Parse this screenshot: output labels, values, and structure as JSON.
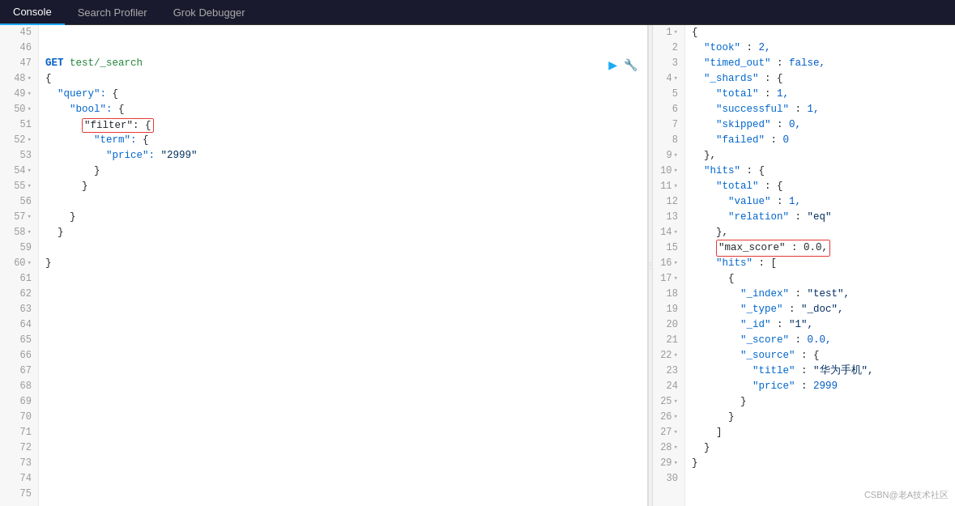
{
  "nav": {
    "tabs": [
      {
        "id": "console",
        "label": "Console",
        "active": true
      },
      {
        "id": "search-profiler",
        "label": "Search Profiler",
        "active": false
      },
      {
        "id": "grok-debugger",
        "label": "Grok Debugger",
        "active": false
      }
    ]
  },
  "editor": {
    "lines": [
      {
        "num": "45",
        "fold": false,
        "content": "",
        "type": "empty"
      },
      {
        "num": "46",
        "fold": false,
        "content": "",
        "type": "empty"
      },
      {
        "num": "47",
        "fold": false,
        "content": "GET test/_search",
        "type": "method"
      },
      {
        "num": "48",
        "fold": true,
        "content": "{",
        "type": "brace"
      },
      {
        "num": "49",
        "fold": true,
        "content": "  \"query\": {",
        "type": "key-brace"
      },
      {
        "num": "50",
        "fold": true,
        "content": "    \"bool\": {",
        "type": "key-brace"
      },
      {
        "num": "51",
        "fold": false,
        "content": "      \"filter\": {",
        "type": "highlighted-key",
        "highlight": true
      },
      {
        "num": "52",
        "fold": true,
        "content": "        \"term\": {",
        "type": "key-brace"
      },
      {
        "num": "53",
        "fold": false,
        "content": "          \"price\": \"2999\"",
        "type": "key-val"
      },
      {
        "num": "54",
        "fold": true,
        "content": "        }",
        "type": "brace"
      },
      {
        "num": "55",
        "fold": true,
        "content": "      }",
        "type": "brace"
      },
      {
        "num": "56",
        "fold": false,
        "content": "",
        "type": "empty"
      },
      {
        "num": "57",
        "fold": true,
        "content": "    }",
        "type": "brace"
      },
      {
        "num": "58",
        "fold": true,
        "content": "  }",
        "type": "brace"
      },
      {
        "num": "59",
        "fold": false,
        "content": "",
        "type": "empty"
      },
      {
        "num": "60",
        "fold": true,
        "content": "}",
        "type": "brace"
      },
      {
        "num": "61",
        "fold": false,
        "content": "",
        "type": "empty"
      },
      {
        "num": "62",
        "fold": false,
        "content": "",
        "type": "empty"
      },
      {
        "num": "63",
        "fold": false,
        "content": "",
        "type": "empty"
      },
      {
        "num": "64",
        "fold": false,
        "content": "",
        "type": "empty"
      },
      {
        "num": "65",
        "fold": false,
        "content": "",
        "type": "empty"
      },
      {
        "num": "66",
        "fold": false,
        "content": "",
        "type": "empty"
      },
      {
        "num": "67",
        "fold": false,
        "content": "",
        "type": "empty"
      },
      {
        "num": "68",
        "fold": false,
        "content": "",
        "type": "empty"
      },
      {
        "num": "69",
        "fold": false,
        "content": "",
        "type": "empty"
      },
      {
        "num": "70",
        "fold": false,
        "content": "",
        "type": "empty"
      },
      {
        "num": "71",
        "fold": false,
        "content": "",
        "type": "empty"
      },
      {
        "num": "72",
        "fold": false,
        "content": "",
        "type": "empty"
      },
      {
        "num": "73",
        "fold": false,
        "content": "",
        "type": "empty"
      },
      {
        "num": "74",
        "fold": false,
        "content": "",
        "type": "empty"
      },
      {
        "num": "75",
        "fold": false,
        "content": "",
        "type": "empty"
      }
    ]
  },
  "response": {
    "lines": [
      {
        "num": "1",
        "fold": true,
        "content": "{"
      },
      {
        "num": "2",
        "fold": false,
        "content": "  \"took\" : 2,"
      },
      {
        "num": "3",
        "fold": false,
        "content": "  \"timed_out\" : false,"
      },
      {
        "num": "4",
        "fold": true,
        "content": "  \"_shards\" : {"
      },
      {
        "num": "5",
        "fold": false,
        "content": "    \"total\" : 1,"
      },
      {
        "num": "6",
        "fold": false,
        "content": "    \"successful\" : 1,"
      },
      {
        "num": "7",
        "fold": false,
        "content": "    \"skipped\" : 0,"
      },
      {
        "num": "8",
        "fold": false,
        "content": "    \"failed\" : 0"
      },
      {
        "num": "9",
        "fold": true,
        "content": "  },"
      },
      {
        "num": "10",
        "fold": true,
        "content": "  \"hits\" : {"
      },
      {
        "num": "11",
        "fold": true,
        "content": "    \"total\" : {"
      },
      {
        "num": "12",
        "fold": false,
        "content": "      \"value\" : 1,"
      },
      {
        "num": "13",
        "fold": false,
        "content": "      \"relation\" : \"eq\""
      },
      {
        "num": "14",
        "fold": true,
        "content": "    },"
      },
      {
        "num": "15",
        "fold": false,
        "content": "    \"max_score\" : 0.0,",
        "highlight": true
      },
      {
        "num": "16",
        "fold": true,
        "content": "    \"hits\" : ["
      },
      {
        "num": "17",
        "fold": true,
        "content": "      {"
      },
      {
        "num": "18",
        "fold": false,
        "content": "        \"_index\" : \"test\","
      },
      {
        "num": "19",
        "fold": false,
        "content": "        \"_type\" : \"_doc\","
      },
      {
        "num": "20",
        "fold": false,
        "content": "        \"_id\" : \"1\","
      },
      {
        "num": "21",
        "fold": false,
        "content": "        \"_score\" : 0.0,"
      },
      {
        "num": "22",
        "fold": true,
        "content": "        \"_source\" : {"
      },
      {
        "num": "23",
        "fold": false,
        "content": "          \"title\" : \"华为手机\","
      },
      {
        "num": "24",
        "fold": false,
        "content": "          \"price\" : 2999"
      },
      {
        "num": "25",
        "fold": true,
        "content": "        }"
      },
      {
        "num": "26",
        "fold": true,
        "content": "      }"
      },
      {
        "num": "27",
        "fold": true,
        "content": "    ]"
      },
      {
        "num": "28",
        "fold": true,
        "content": "  }"
      },
      {
        "num": "29",
        "fold": true,
        "content": "}"
      },
      {
        "num": "30",
        "fold": false,
        "content": ""
      }
    ]
  },
  "icons": {
    "play": "▶",
    "wrench": "🔧",
    "divider_dots": "⋮"
  },
  "watermark": "CSBN@老A技术社区"
}
